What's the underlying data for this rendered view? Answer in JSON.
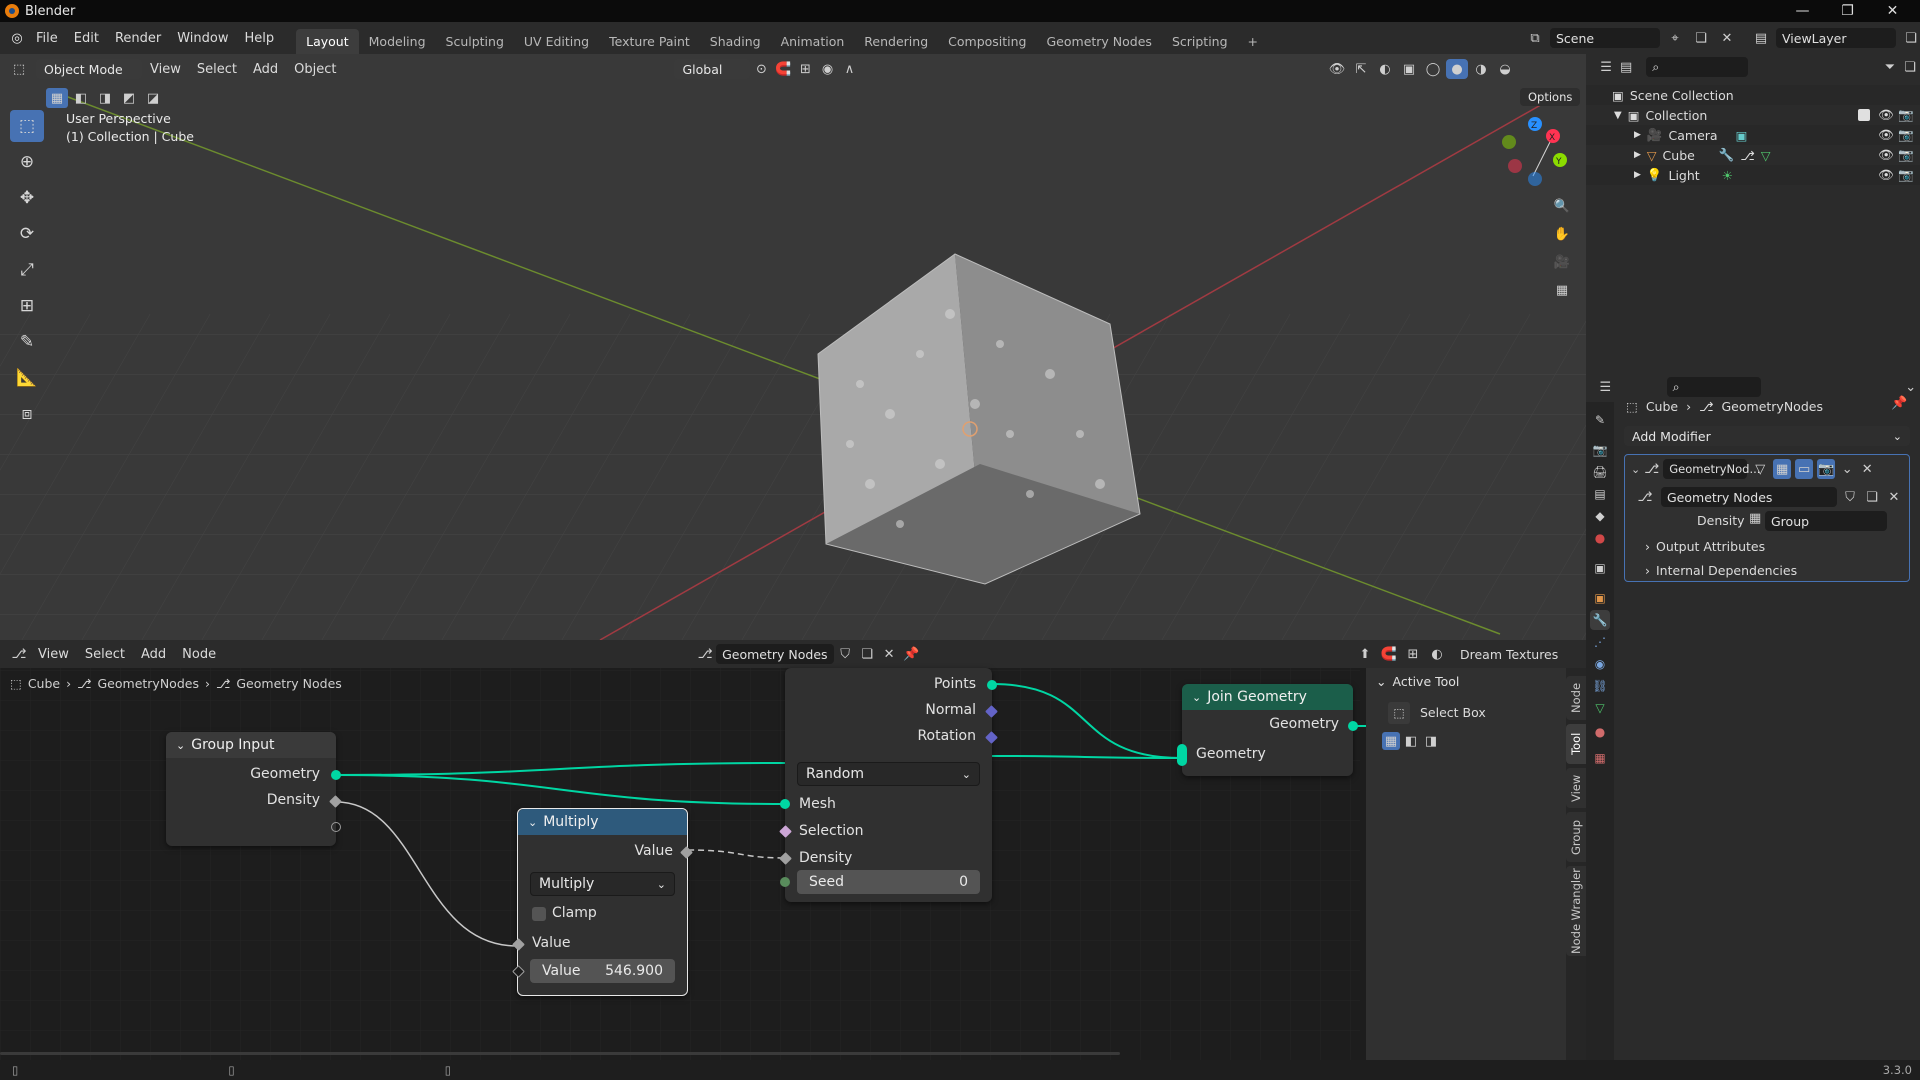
{
  "titlebar": {
    "app_title": "Blender"
  },
  "menu": [
    "File",
    "Edit",
    "Render",
    "Window",
    "Help"
  ],
  "workspaces": [
    "Layout",
    "Modeling",
    "Sculpting",
    "UV Editing",
    "Texture Paint",
    "Shading",
    "Animation",
    "Rendering",
    "Compositing",
    "Geometry Nodes",
    "Scripting"
  ],
  "workspace_add": "+",
  "scene": {
    "name": "Scene",
    "view_layer": "ViewLayer"
  },
  "viewport": {
    "mode": "Object Mode",
    "menus": [
      "View",
      "Select",
      "Add",
      "Object"
    ],
    "transform_orientation": "Global",
    "options_label": "Options",
    "overlay_line1": "User Perspective",
    "overlay_line2": "(1) Collection | Cube",
    "gizmo": {
      "x": "X",
      "y": "Y",
      "z": "Z"
    }
  },
  "node_editor": {
    "menus": [
      "View",
      "Select",
      "Add",
      "Node"
    ],
    "tree_name": "Geometry Nodes",
    "right_label": "Dream Textures",
    "breadcrumbs": [
      "Cube",
      "GeometryNodes",
      "Geometry Nodes"
    ],
    "group_input": {
      "title": "Group Input",
      "geometry": "Geometry",
      "density": "Density"
    },
    "multiply": {
      "title": "Multiply",
      "out_value": "Value",
      "operation": "Multiply",
      "clamp": "Clamp",
      "in_value": "Value",
      "field_label": "Value",
      "field_value": "546.900"
    },
    "distribute": {
      "points": "Points",
      "normal": "Normal",
      "rotation": "Rotation",
      "mode": "Random",
      "mesh": "Mesh",
      "selection": "Selection",
      "density": "Density",
      "seed_label": "Seed",
      "seed_value": "0"
    },
    "join": {
      "title": "Join Geometry",
      "out": "Geometry",
      "in": "Geometry"
    },
    "sidebar": {
      "title": "Active Tool",
      "tool": "Select Box"
    },
    "vtabs": [
      "Node",
      "Tool",
      "View",
      "Group",
      "Node Wrangler"
    ]
  },
  "outliner": {
    "root": "Scene Collection",
    "collection": "Collection",
    "items": [
      "Camera",
      "Cube",
      "Light"
    ]
  },
  "properties": {
    "breadcrumb_object": "Cube",
    "breadcrumb_modifier": "GeometryNodes",
    "add_modifier": "Add Modifier",
    "modifier_name": "GeometryNod...",
    "node_group": "Geometry Nodes",
    "density_label": "Density",
    "density_value": "Group",
    "output_attributes": "Output Attributes",
    "internal_dependencies": "Internal Dependencies"
  },
  "status": {
    "version": "3.3.0"
  },
  "colors": {
    "accent": "#4772b3",
    "geometry_socket": "#00d6a3",
    "header_green": "#1b5e4a",
    "header_blue": "#2e5a7c"
  }
}
